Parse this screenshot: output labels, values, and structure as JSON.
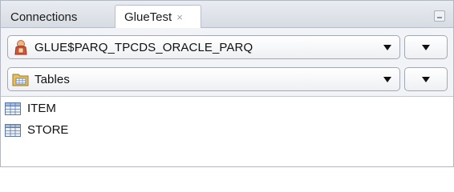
{
  "tabs": {
    "connections_label": "Connections",
    "gluetest_label": "GlueTest",
    "close_glyph": "×"
  },
  "schema_selector": {
    "value": "GLUE$PARQ_TPCDS_ORACLE_PARQ",
    "icon": "user-icon"
  },
  "type_selector": {
    "value": "Tables",
    "icon": "folder-icon"
  },
  "items": [
    {
      "label": "ITEM",
      "icon": "table-icon"
    },
    {
      "label": "STORE",
      "icon": "table-icon"
    }
  ],
  "colors": {
    "tabbar_bg": "#dde1e7",
    "toolbar_bg": "#f1f3f6",
    "user_icon": "#d9583b",
    "folder_icon": "#e8c15a",
    "table_icon": "#5a78a8"
  }
}
